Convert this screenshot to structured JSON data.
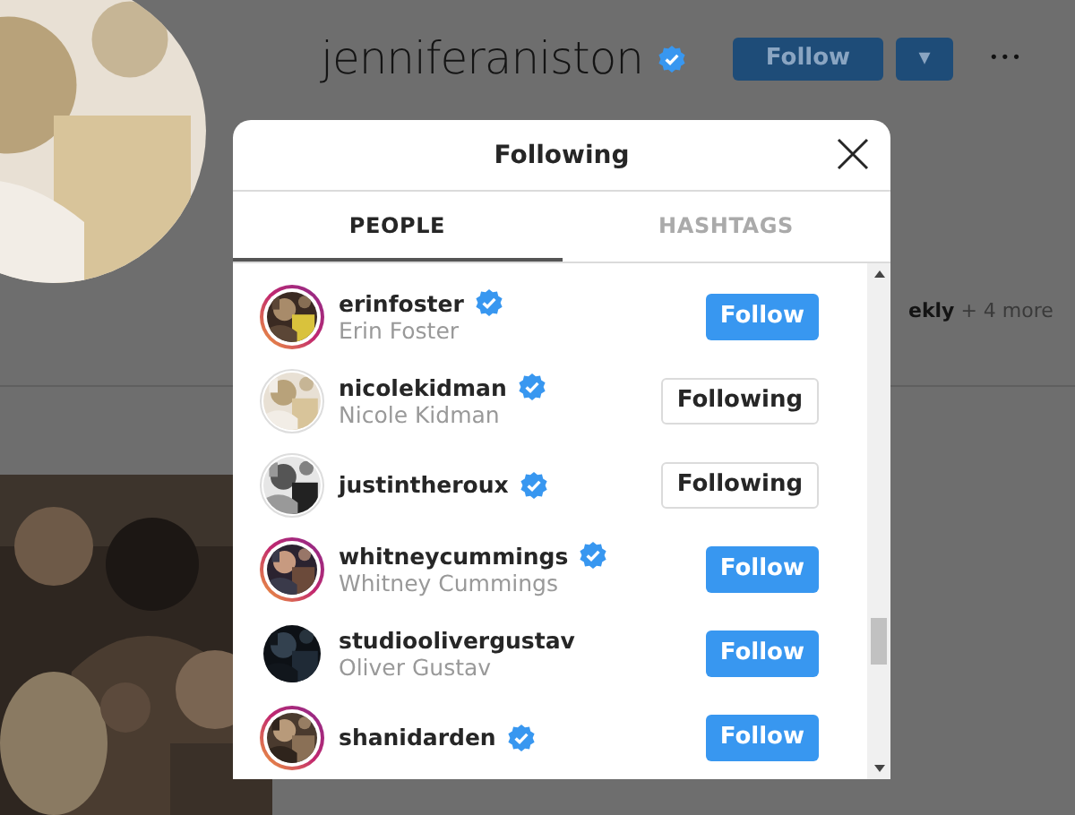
{
  "profile": {
    "username": "jenniferaniston",
    "verified": true,
    "follow_button": "Follow",
    "dropdown_button": "▾",
    "more_button": "•••",
    "followed_by": "**ekly** + 4 more"
  },
  "modal": {
    "title": "Following",
    "tabs": [
      {
        "label": "PEOPLE",
        "selected": true
      },
      {
        "label": "HASHTAGS",
        "selected": false
      }
    ],
    "accounts": [
      {
        "username": "erinfoster",
        "name": "Erin Foster",
        "verified": true,
        "story_ring": true,
        "following": false,
        "button": "Follow"
      },
      {
        "username": "nicolekidman",
        "name": "Nicole Kidman",
        "verified": true,
        "story_ring": false,
        "following": true,
        "button": "Following"
      },
      {
        "username": "justintheroux",
        "verified": true,
        "story_ring": false,
        "following": true,
        "button": "Following"
      },
      {
        "username": "whitneycummings",
        "name": "Whitney Cummings",
        "verified": true,
        "story_ring": true,
        "following": false,
        "button": "Follow"
      },
      {
        "username": "studioolivergustav",
        "name": "Oliver Gustav",
        "verified": false,
        "story_ring": false,
        "following": false,
        "button": "Follow"
      },
      {
        "username": "shanidarden",
        "verified": true,
        "story_ring": true,
        "following": false,
        "button": "Follow"
      }
    ]
  }
}
